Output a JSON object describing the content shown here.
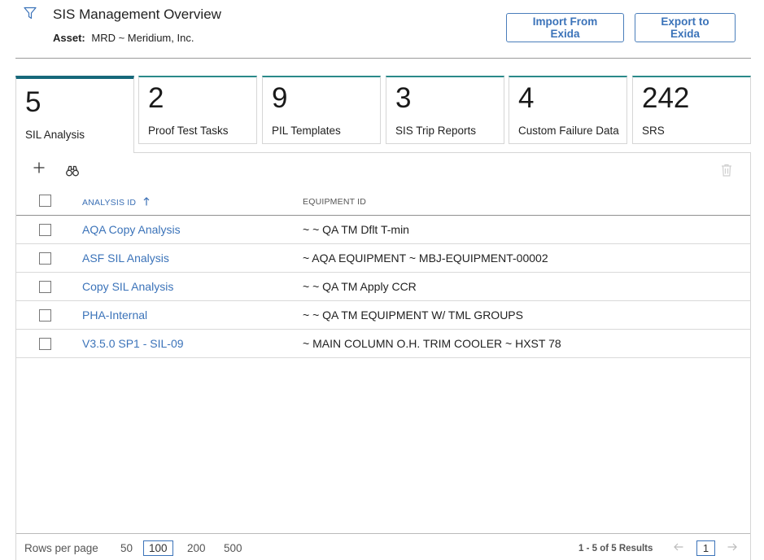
{
  "header": {
    "title": "SIS Management Overview",
    "asset_label": "Asset:",
    "asset_value": "MRD ~ Meridium, Inc.",
    "import_button": "Import From Exida",
    "export_button": "Export to Exida"
  },
  "tiles": [
    {
      "count": "5",
      "label": "SIL Analysis",
      "active": true
    },
    {
      "count": "2",
      "label": "Proof Test Tasks"
    },
    {
      "count": "9",
      "label": "PIL Templates"
    },
    {
      "count": "3",
      "label": "SIS Trip Reports"
    },
    {
      "count": "4",
      "label": "Custom Failure Data"
    },
    {
      "count": "242",
      "label": "SRS"
    }
  ],
  "toolbar": {
    "icons": [
      "plus-icon",
      "binoculars-icon",
      "trash-icon"
    ]
  },
  "table": {
    "columns": [
      "ANALYSIS ID",
      "EQUIPMENT ID"
    ],
    "rows": [
      {
        "analysis_id": "AQA Copy Analysis",
        "equipment_id": "~ ~ QA TM Dflt T-min"
      },
      {
        "analysis_id": "ASF SIL Analysis",
        "equipment_id": "~ AQA EQUIPMENT ~ MBJ-EQUIPMENT-00002"
      },
      {
        "analysis_id": "Copy SIL Analysis",
        "equipment_id": "~ ~ QA TM Apply CCR"
      },
      {
        "analysis_id": "PHA-Internal",
        "equipment_id": "~ ~ QA TM EQUIPMENT W/ TML GROUPS"
      },
      {
        "analysis_id": "V3.5.0 SP1 - SIL-09",
        "equipment_id": "~ MAIN COLUMN O.H. TRIM COOLER ~ HXST 78"
      }
    ]
  },
  "footer": {
    "rows_per_page_label": "Rows per page",
    "options": [
      "50",
      "100",
      "200",
      "500"
    ],
    "selected_option": "100",
    "results_text": "1 - 5 of 5 Results",
    "current_page": "1"
  },
  "colors": {
    "accent_teal": "#17687a",
    "link_blue": "#3b73b9"
  }
}
